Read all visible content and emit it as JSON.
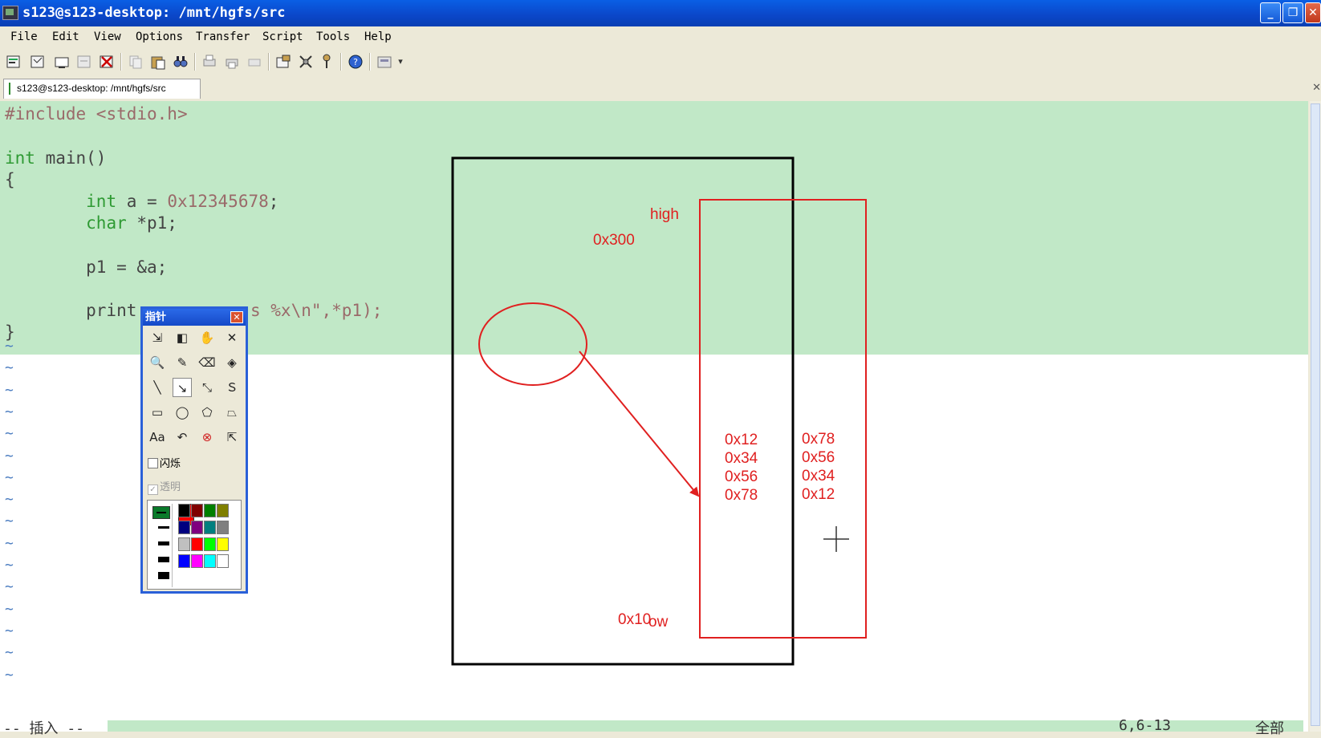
{
  "window": {
    "title": "s123@s123-desktop: /mnt/hgfs/src",
    "minimize_glyph": "_",
    "restore_glyph": "❐",
    "close_glyph": "✕"
  },
  "menu": [
    "File",
    "Edit",
    "View",
    "Options",
    "Transfer",
    "Script",
    "Tools",
    "Help"
  ],
  "toolbar": {
    "icons": [
      "new-session-icon",
      "new-window-icon",
      "open-icon",
      "reconnect-icon",
      "disconnect-icon",
      "copy-icon",
      "paste-icon",
      "find-icon",
      "print-icon",
      "print-screen-icon",
      "print-setup-icon",
      "session-options-icon",
      "global-options-icon",
      "keymap-icon",
      "help-icon",
      "sftp-icon"
    ],
    "overflow_glyph": "▾"
  },
  "tab": {
    "label": "s123@s123-desktop: /mnt/hgfs/src",
    "close_glyph": "✕"
  },
  "editor": {
    "line1": {
      "pp": "#include",
      "rest": " <stdio.h>"
    },
    "line2": {
      "kw": "int",
      "rest": " main()"
    },
    "line3": "{",
    "line4": {
      "indent": "        ",
      "kw": "int",
      "mid": " a = ",
      "num": "0x12345678",
      "tail": ";"
    },
    "line5": {
      "indent": "        ",
      "kw": "char",
      "rest": " *p1;"
    },
    "line6": "        p1 = &a;",
    "line7": {
      "head": "        print",
      "tail": "s %x\\n\",*p1);"
    },
    "line8": "}",
    "tilde": "~",
    "tilde_count": 16
  },
  "status": {
    "mode": "-- 插入 --",
    "position": "6,6-13",
    "scroll": "全部"
  },
  "annotations": {
    "high": "high",
    "addr_high": "0x300",
    "addr_low": "0x10",
    "low_fragment": "ow",
    "col1": [
      "0x12",
      "0x34",
      "0x56",
      "0x78"
    ],
    "col2": [
      "0x78",
      "0x56",
      "0x34",
      "0x12"
    ],
    "pen_color": "#e02020"
  },
  "palette": {
    "title": "指针",
    "close_glyph": "✕",
    "tools": [
      "import-icon",
      "invert-icon",
      "hand-icon",
      "delete-icon",
      "magnifier-icon",
      "pencil-icon",
      "eraser-icon",
      "fill-icon",
      "line-icon",
      "arrow-icon",
      "double-arrow-icon",
      "curve-icon",
      "rectangle-icon",
      "ellipse-icon",
      "polygon-icon",
      "freeform-icon",
      "text-icon",
      "undo-icon",
      "clear-icon",
      "pointer-hide-icon"
    ],
    "tool_glyphs": [
      "⇲",
      "◧",
      "✋",
      "✕",
      "🔍",
      "✎",
      "⌫",
      "◈",
      "╲",
      "↘",
      "⤡",
      "Ｓ",
      "▭",
      "◯",
      "⬠",
      "⏢",
      "Aa",
      "↶",
      "⊗",
      "⇱"
    ],
    "blink_label": "闪烁",
    "transparent_label": "透明",
    "check_glyph": "✓",
    "colors": [
      "#000000",
      "#7f0000",
      "#007f00",
      "#7f7f00",
      "#00007f",
      "#7f007f",
      "#007f7f",
      "#808080",
      "#c0c0c0",
      "#ff0000",
      "#00ff00",
      "#ffff00",
      "#0000ff",
      "#ff00ff",
      "#00ffff",
      "#ffffff"
    ],
    "current_color": "#ff0000"
  }
}
